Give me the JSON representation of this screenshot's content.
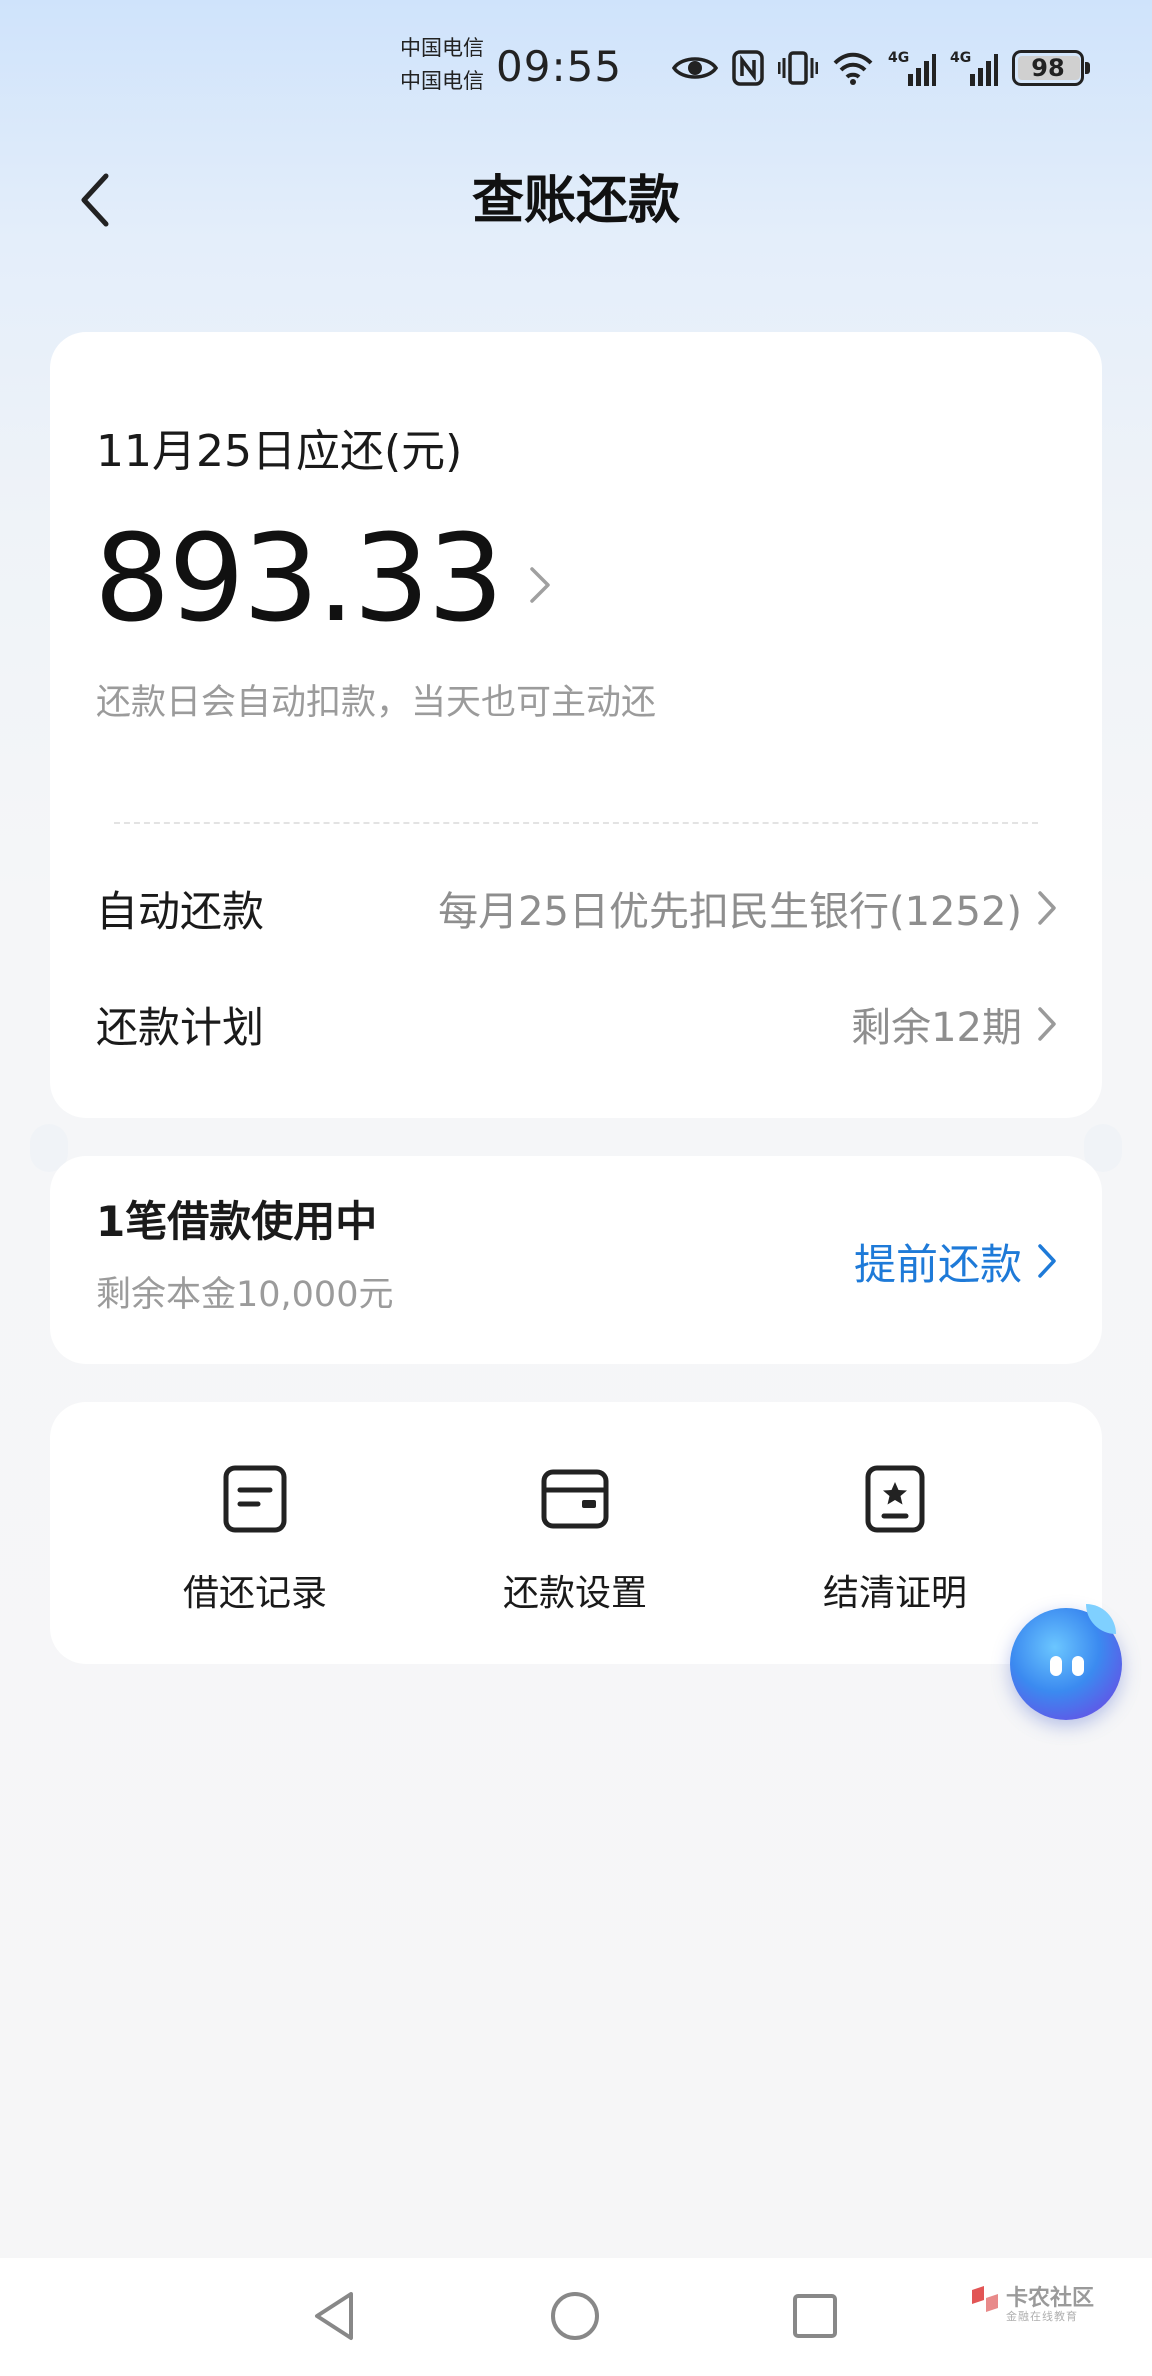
{
  "status_bar": {
    "carrier_1": "中国电信",
    "carrier_2": "中国电信",
    "time": "09:55",
    "battery": "98",
    "icons": [
      "eye-icon",
      "nfc-icon",
      "vibrate-icon",
      "wifi-icon",
      "signal-4g-icon",
      "signal-4g-icon",
      "battery-icon"
    ]
  },
  "header": {
    "title": "查账还款"
  },
  "due_card": {
    "label": "11月25日应还(元)",
    "amount": "893.33",
    "note": "还款日会自动扣款，当天也可主动还",
    "auto_repay": {
      "label": "自动还款",
      "value": "每月25日优先扣民生银行(1252)"
    },
    "plan": {
      "label": "还款计划",
      "value": "剩余12期"
    }
  },
  "loan_card": {
    "title": "1笔借款使用中",
    "subtitle": "剩余本金10,000元",
    "action": "提前还款"
  },
  "actions": [
    {
      "label": "借还记录",
      "icon": "record-icon"
    },
    {
      "label": "还款设置",
      "icon": "wallet-icon"
    },
    {
      "label": "结清证明",
      "icon": "certificate-icon"
    }
  ],
  "watermark": {
    "text": "卡农社区",
    "sub": "金融在线教育"
  },
  "colors": {
    "accent": "#1e7ad8",
    "muted_text": "#9b9b9b",
    "card_bg": "#ffffff"
  }
}
